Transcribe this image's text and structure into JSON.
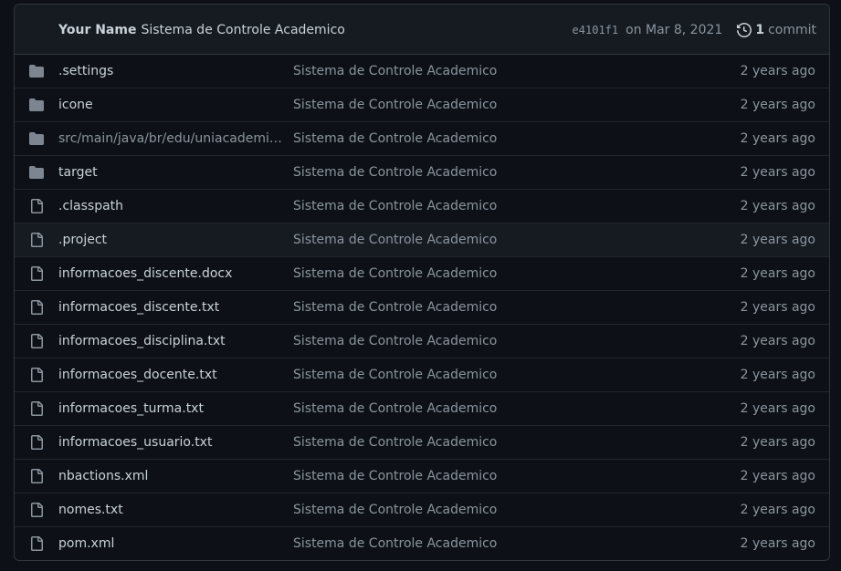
{
  "header": {
    "author": "Your Name",
    "message": "Sistema de Controle Academico",
    "sha": "e4101f1",
    "date": "on Mar 8, 2021",
    "commit_count": "1",
    "commit_label": "commit",
    "history_icon": "history-icon"
  },
  "colors": {
    "background": "#0d1117",
    "header_bg": "#161b22",
    "border": "#30363d",
    "text": "#c9d1d9",
    "muted": "#8b949e",
    "folder": "#7d8590"
  },
  "files": [
    {
      "type": "folder",
      "icon": "folder-icon",
      "name": ".settings",
      "message": "Sistema de Controle Academico",
      "age": "2 years ago"
    },
    {
      "type": "folder",
      "icon": "folder-icon",
      "name": "icone",
      "message": "Sistema de Controle Academico",
      "age": "2 years ago"
    },
    {
      "type": "folder",
      "icon": "folder-icon",
      "name": "src/main/java/br/edu/uniacademia…",
      "message": "Sistema de Controle Academico",
      "age": "2 years ago"
    },
    {
      "type": "folder",
      "icon": "folder-icon",
      "name": "target",
      "message": "Sistema de Controle Academico",
      "age": "2 years ago"
    },
    {
      "type": "file",
      "icon": "file-icon",
      "name": ".classpath",
      "message": "Sistema de Controle Academico",
      "age": "2 years ago"
    },
    {
      "type": "file",
      "icon": "file-icon",
      "name": ".project",
      "message": "Sistema de Controle Academico",
      "age": "2 years ago"
    },
    {
      "type": "file",
      "icon": "file-icon",
      "name": "informacoes_discente.docx",
      "message": "Sistema de Controle Academico",
      "age": "2 years ago"
    },
    {
      "type": "file",
      "icon": "file-icon",
      "name": "informacoes_discente.txt",
      "message": "Sistema de Controle Academico",
      "age": "2 years ago"
    },
    {
      "type": "file",
      "icon": "file-icon",
      "name": "informacoes_disciplina.txt",
      "message": "Sistema de Controle Academico",
      "age": "2 years ago"
    },
    {
      "type": "file",
      "icon": "file-icon",
      "name": "informacoes_docente.txt",
      "message": "Sistema de Controle Academico",
      "age": "2 years ago"
    },
    {
      "type": "file",
      "icon": "file-icon",
      "name": "informacoes_turma.txt",
      "message": "Sistema de Controle Academico",
      "age": "2 years ago"
    },
    {
      "type": "file",
      "icon": "file-icon",
      "name": "informacoes_usuario.txt",
      "message": "Sistema de Controle Academico",
      "age": "2 years ago"
    },
    {
      "type": "file",
      "icon": "file-icon",
      "name": "nbactions.xml",
      "message": "Sistema de Controle Academico",
      "age": "2 years ago"
    },
    {
      "type": "file",
      "icon": "file-icon",
      "name": "nomes.txt",
      "message": "Sistema de Controle Academico",
      "age": "2 years ago"
    },
    {
      "type": "file",
      "icon": "file-icon",
      "name": "pom.xml",
      "message": "Sistema de Controle Academico",
      "age": "2 years ago"
    }
  ]
}
